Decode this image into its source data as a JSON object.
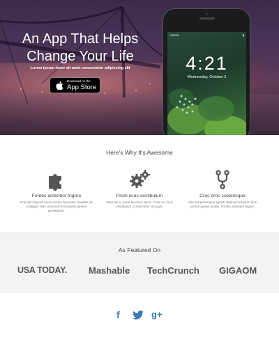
{
  "hero": {
    "title_line1": "An App That Helps",
    "title_line2": "Change Your Life",
    "subtitle": "Lorem ipsum dolor sit amet consectetur adipiscing elit",
    "store_button": {
      "small_label": "Download on the",
      "big_label": "App Store"
    }
  },
  "phone": {
    "carrier": "VIRGIN",
    "time_status": "",
    "clock": "4:21",
    "date": "Wednesday, October 2"
  },
  "features": {
    "section_title": "Here's Why It's Awesome",
    "items": [
      {
        "name": "Fontes ardentior frigore",
        "description": "Principio figuras omnia divino facientes inhabilis ab nullaque. Illas unus secrevit quanto gentes persegitant.",
        "icon": "puzzle-icon"
      },
      {
        "name": "Proin risus vestibulum",
        "description": "Vitae elit a, porta faucibus purus. Proin eu risus vestibulum, consectetur nisi quis.",
        "icon": "gears-icon"
      },
      {
        "name": "Cras eros scelerisque",
        "description": "Alia temperiemque ligavit! distinxit inclusum illos pontus aquae undae. Fontes ardentior frigore.",
        "icon": "branch-icon"
      }
    ]
  },
  "featured": {
    "section_title": "As Featured On",
    "logos": [
      "USA TODAY.",
      "Mashable",
      "TechCrunch",
      "GIGAOM"
    ]
  },
  "social": {
    "icons": [
      "facebook-icon",
      "twitter-icon",
      "google-plus-icon"
    ],
    "labels": [
      "f",
      "",
      "g+"
    ],
    "color": "#3a79b8"
  },
  "colors": {
    "hero_overlay": "#4a3558",
    "featured_bg": "#f3f3f3",
    "text_dark": "#444444",
    "social_blue": "#3a79b8"
  }
}
